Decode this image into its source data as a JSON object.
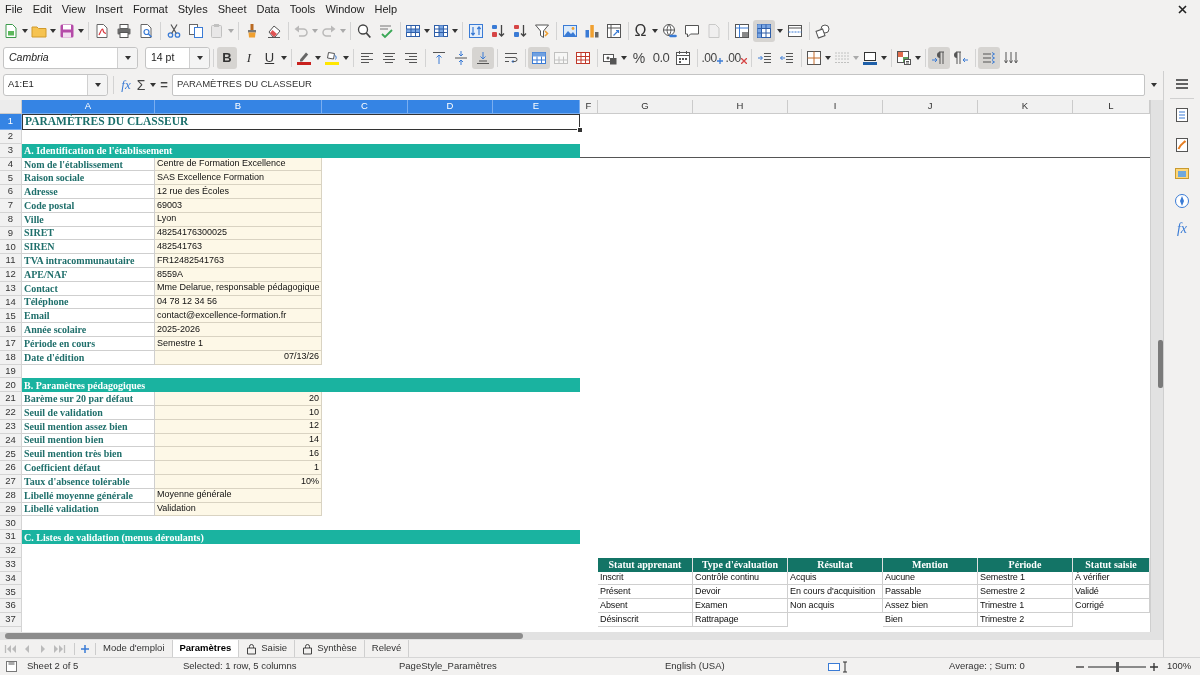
{
  "menu_bar": {
    "items": [
      "File",
      "Edit",
      "View",
      "Insert",
      "Format",
      "Styles",
      "Sheet",
      "Data",
      "Tools",
      "Window",
      "Help"
    ]
  },
  "standard_toolbar": {
    "special_character": "Ω",
    "pressed": {
      "freeze_panes": true
    }
  },
  "formatting_toolbar": {
    "font_name": "Cambria",
    "font_size": "14 pt",
    "text_toggles": [
      {
        "kind": "bold",
        "label": "B",
        "on": true
      },
      {
        "kind": "italic",
        "label": "I",
        "on": false
      },
      {
        "kind": "underline",
        "label": "U",
        "on": false
      }
    ],
    "pressed": {
      "align_bottom": true,
      "merge_and_center": true,
      "left_to_right": true,
      "text_direction": true
    },
    "percent_format": "%",
    "number_format": "0.0",
    "add_decimal": ".00",
    "delete_decimal": ".00"
  },
  "formula_bar": {
    "name_box": "A1:E1",
    "function_wizard": "fx",
    "sum": "Σ",
    "equals": "=",
    "content": "PARAMÈTRES DU CLASSEUR"
  },
  "sheet": {
    "columns": [
      {
        "label": "A",
        "selected": true
      },
      {
        "label": "B",
        "selected": true
      },
      {
        "label": "C",
        "selected": true
      },
      {
        "label": "D",
        "selected": true
      },
      {
        "label": "E",
        "selected": true
      },
      {
        "label": "F",
        "selected": false
      },
      {
        "label": "G",
        "selected": false
      },
      {
        "label": "H",
        "selected": false
      },
      {
        "label": "I",
        "selected": false
      },
      {
        "label": "J",
        "selected": false
      },
      {
        "label": "K",
        "selected": false
      },
      {
        "label": "L",
        "selected": false
      }
    ],
    "rows": [
      {
        "label": "1",
        "selected": true
      },
      {
        "label": "2",
        "selected": false
      },
      {
        "label": "3",
        "selected": false
      },
      {
        "label": "4",
        "selected": false
      },
      {
        "label": "5",
        "selected": false
      },
      {
        "label": "6",
        "selected": false
      },
      {
        "label": "7",
        "selected": false
      },
      {
        "label": "8",
        "selected": false
      },
      {
        "label": "9",
        "selected": false
      },
      {
        "label": "10",
        "selected": false
      },
      {
        "label": "11",
        "selected": false
      },
      {
        "label": "12",
        "selected": false
      },
      {
        "label": "13",
        "selected": false
      },
      {
        "label": "14",
        "selected": false
      },
      {
        "label": "15",
        "selected": false
      },
      {
        "label": "16",
        "selected": false
      },
      {
        "label": "17",
        "selected": false
      },
      {
        "label": "18",
        "selected": false
      },
      {
        "label": "19",
        "selected": false
      },
      {
        "label": "20",
        "selected": false
      },
      {
        "label": "21",
        "selected": false
      },
      {
        "label": "22",
        "selected": false
      },
      {
        "label": "23",
        "selected": false
      },
      {
        "label": "24",
        "selected": false
      },
      {
        "label": "25",
        "selected": false
      },
      {
        "label": "26",
        "selected": false
      },
      {
        "label": "27",
        "selected": false
      },
      {
        "label": "28",
        "selected": false
      },
      {
        "label": "29",
        "selected": false
      },
      {
        "label": "30",
        "selected": false
      },
      {
        "label": "31",
        "selected": false
      },
      {
        "label": "32",
        "selected": false
      },
      {
        "label": "33",
        "selected": false
      },
      {
        "label": "34",
        "selected": false
      },
      {
        "label": "35",
        "selected": false
      },
      {
        "label": "36",
        "selected": false
      },
      {
        "label": "37",
        "selected": false
      }
    ],
    "title": "PARAMÈTRES DU CLASSEUR",
    "sections": [
      {
        "kind": "fields",
        "heading": "A. Identification de l'établissement",
        "fields": [
          {
            "label": "Nom de l'établissement",
            "value": "Centre de Formation Excellence",
            "kind": "text"
          },
          {
            "label": "Raison sociale",
            "value": "SAS Excellence Formation",
            "kind": "text"
          },
          {
            "label": "Adresse",
            "value": "12 rue des Écoles",
            "kind": "text"
          },
          {
            "label": "Code postal",
            "value": "69003",
            "kind": "text"
          },
          {
            "label": "Ville",
            "value": "Lyon",
            "kind": "text"
          },
          {
            "label": "SIRET",
            "value": "48254176300025",
            "kind": "text"
          },
          {
            "label": "SIREN",
            "value": "482541763",
            "kind": "text"
          },
          {
            "label": "TVA intracommunautaire",
            "value": "FR12482541763",
            "kind": "text"
          },
          {
            "label": "APE/NAF",
            "value": "8559A",
            "kind": "text"
          },
          {
            "label": "Contact",
            "value": "Mme Delarue, responsable pédagogique",
            "kind": "text"
          },
          {
            "label": "Téléphone",
            "value": "04 78 12 34 56",
            "kind": "text"
          },
          {
            "label": "Email",
            "value": "contact@excellence-formation.fr",
            "kind": "text"
          },
          {
            "label": "Année scolaire",
            "value": "2025-2026",
            "kind": "text"
          },
          {
            "label": "Période en cours",
            "value": "Semestre 1",
            "kind": "text"
          },
          {
            "label": "Date d'édition",
            "value": "07/13/26",
            "kind": "number"
          }
        ]
      },
      {
        "kind": "fields",
        "heading": "B. Paramètres pédagogiques",
        "fields": [
          {
            "label": "Barème sur 20 par défaut",
            "value": "20",
            "kind": "number"
          },
          {
            "label": "Seuil de validation",
            "value": "10",
            "kind": "number"
          },
          {
            "label": "Seuil mention assez bien",
            "value": "12",
            "kind": "number"
          },
          {
            "label": "Seuil mention bien",
            "value": "14",
            "kind": "number"
          },
          {
            "label": "Seuil mention très bien",
            "value": "16",
            "kind": "number"
          },
          {
            "label": "Coefficient défaut",
            "value": "1",
            "kind": "number"
          },
          {
            "label": "Taux d'absence tolérable",
            "value": "10%",
            "kind": "number"
          },
          {
            "label": "Libellé moyenne générale",
            "value": "Moyenne générale",
            "kind": "text"
          },
          {
            "label": "Libellé validation",
            "value": "Validation",
            "kind": "text"
          }
        ]
      },
      {
        "kind": "lists",
        "heading": "C. Listes de validation (menus déroulants)",
        "lists": [
          {
            "heading": "Statut apprenant",
            "items": [
              "Inscrit",
              "Présent",
              "Absent",
              "Désinscrit"
            ]
          },
          {
            "heading": "Type d'évaluation",
            "items": [
              "Contrôle continu",
              "Devoir",
              "Examen",
              "Rattrapage"
            ]
          },
          {
            "heading": "Résultat",
            "items": [
              "Acquis",
              "En cours d'acquisition",
              "Non acquis"
            ]
          },
          {
            "heading": "Mention",
            "items": [
              "Aucune",
              "Passable",
              "Assez bien",
              "Bien"
            ]
          },
          {
            "heading": "Période",
            "items": [
              "Semestre 1",
              "Semestre 2",
              "Trimestre 1",
              "Trimestre 2"
            ]
          },
          {
            "heading": "Statut saisie",
            "items": [
              "À vérifier",
              "Validé",
              "Corrigé"
            ]
          }
        ]
      }
    ]
  },
  "sheet_tabs": [
    {
      "label": "Mode d'emploi",
      "selected": false,
      "locked": false
    },
    {
      "label": "Paramètres",
      "selected": true,
      "locked": false
    },
    {
      "label": "Saisie",
      "selected": false,
      "locked": true
    },
    {
      "label": "Synthèse",
      "selected": false,
      "locked": true
    },
    {
      "label": "Relevé",
      "selected": false,
      "locked": false
    }
  ],
  "sidebar": {
    "functions": "fx"
  },
  "status_bar": {
    "sheet": "Sheet 2 of 5",
    "selection": "Selected: 1 row, 5 columns",
    "page_style": "PageStyle_Paramètres",
    "language": "English (USA)",
    "summary": "Average: ; Sum: 0",
    "zoom_slider": {
      "level": 0.5
    },
    "zoom": "100%"
  }
}
